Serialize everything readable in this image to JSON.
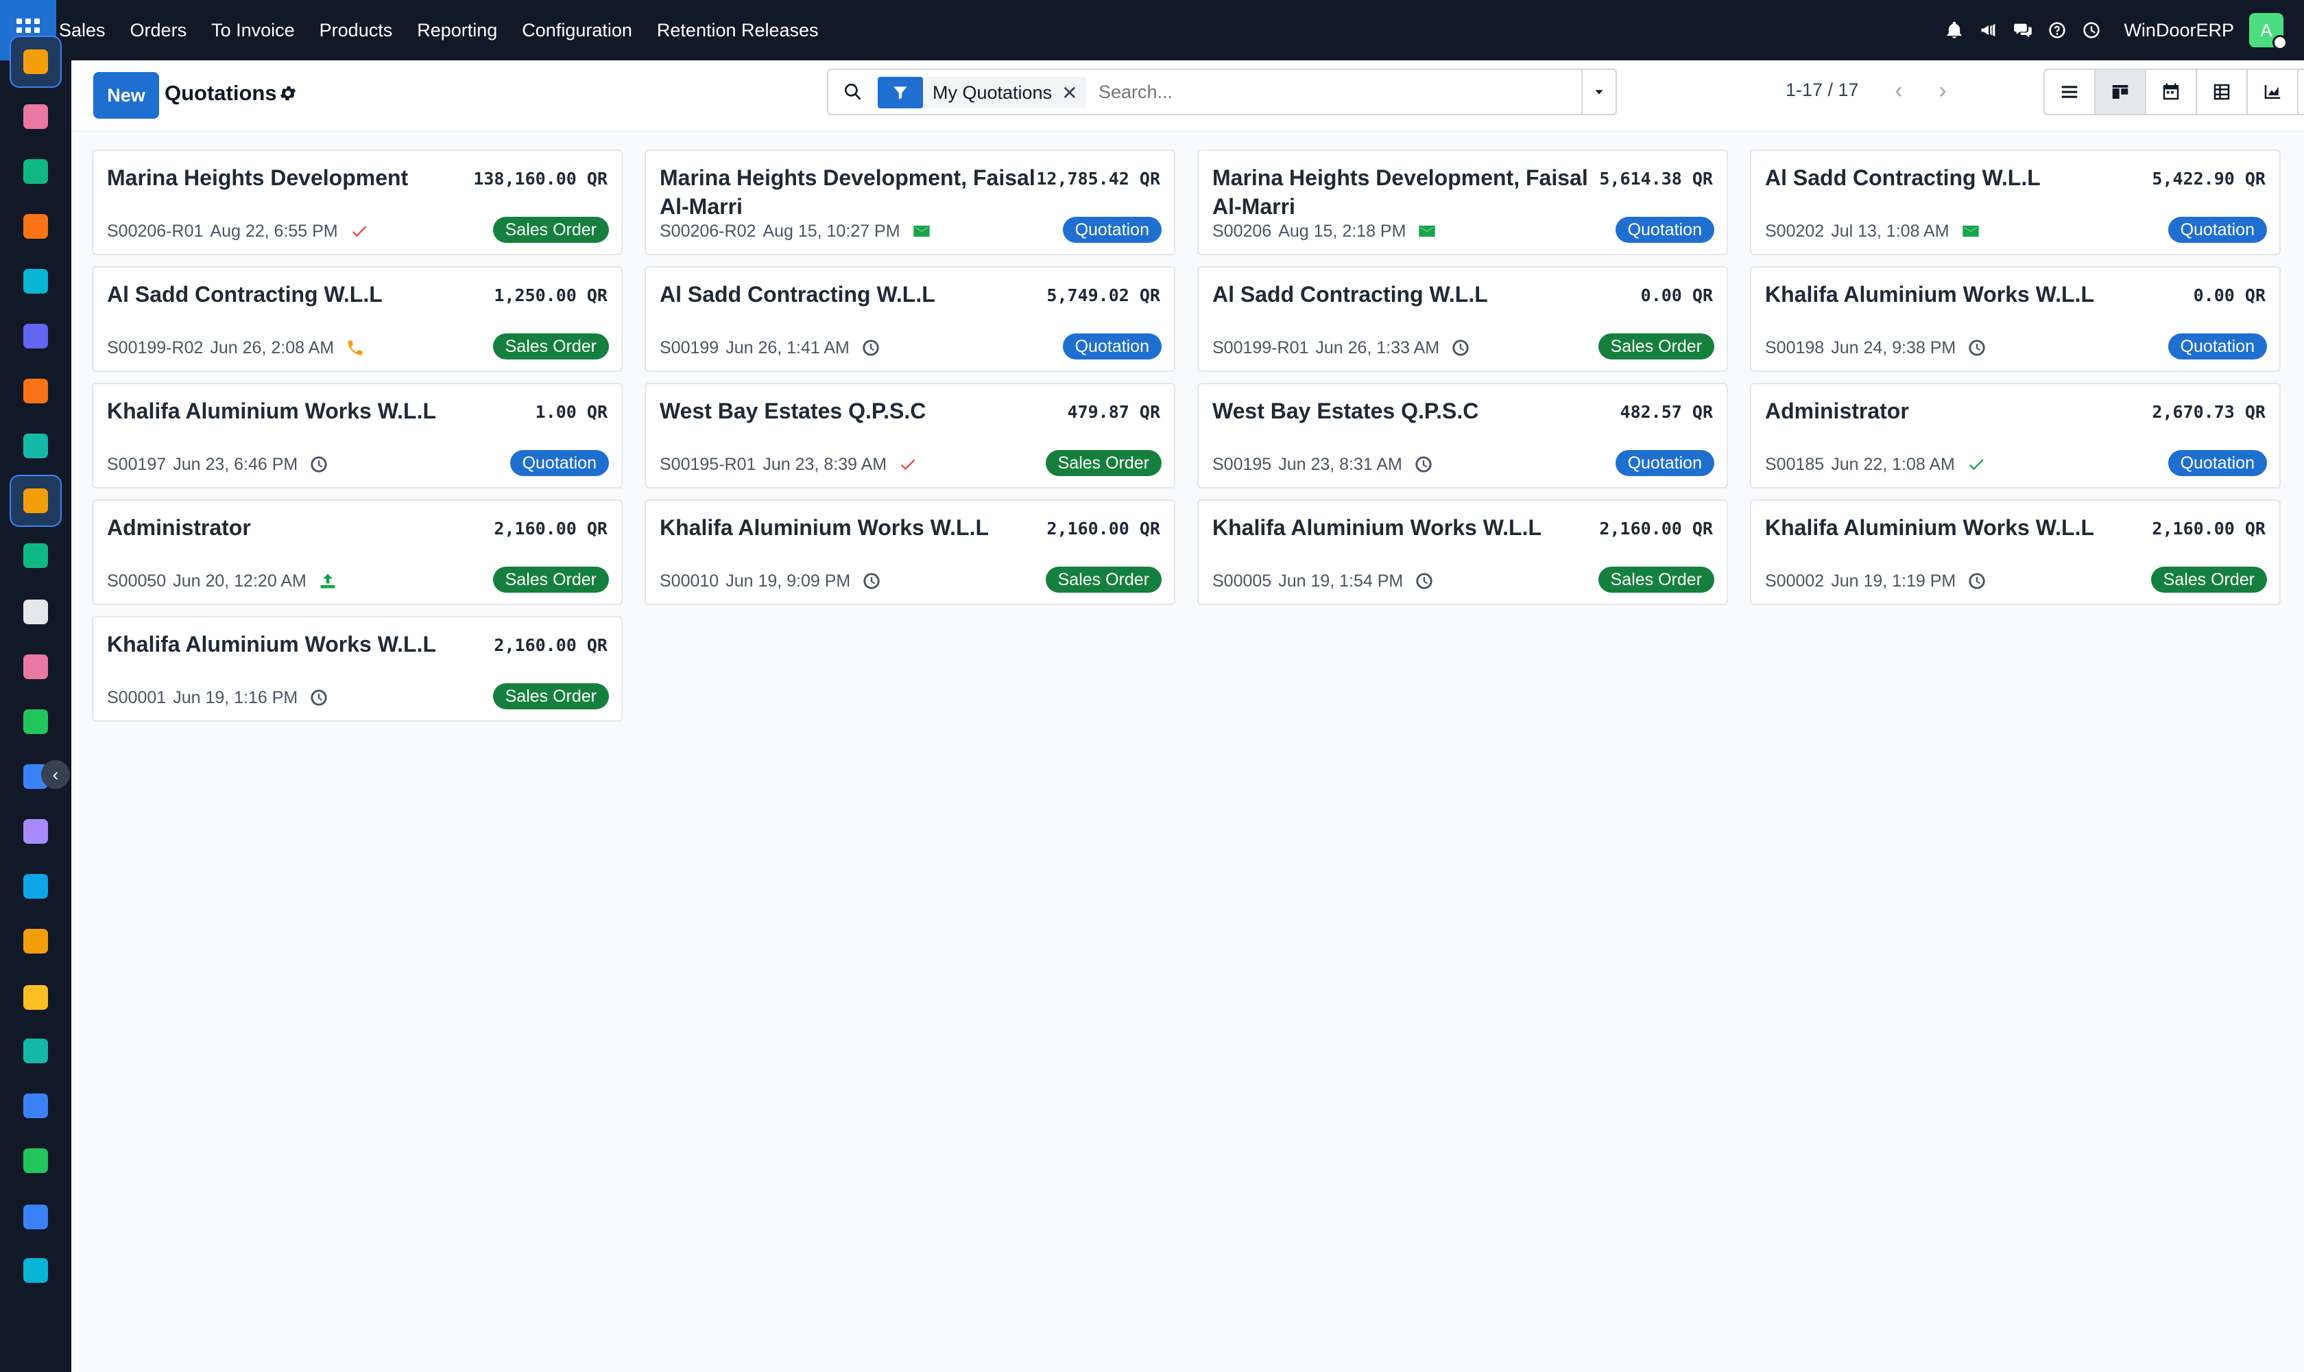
{
  "topbar": {
    "menu": [
      "Sales",
      "Orders",
      "To Invoice",
      "Products",
      "Reporting",
      "Configuration",
      "Retention Releases"
    ],
    "company": "WinDoorERP",
    "avatar_letter": "A"
  },
  "control": {
    "new_label": "New",
    "title": "Quotations",
    "facet_label": "My Quotations",
    "facet_remove": "✕",
    "search_placeholder": "Search...",
    "pager": "1-17 / 17"
  },
  "colors": {
    "quotation": "#1f6fd1",
    "sales_order": "#15803d",
    "topbar": "#111827"
  },
  "cards": [
    {
      "name": "Marina Heights Development",
      "amount": "138,160.00 QR",
      "ref": "S00206-R01",
      "date": "Aug 22, 6:55 PM",
      "activity": "check-done-icon",
      "status": "Sales Order"
    },
    {
      "name": "Marina Heights Development, Faisal Al-Marri",
      "amount": "12,785.42 QR",
      "ref": "S00206-R02",
      "date": "Aug 15, 10:27 PM",
      "activity": "email-icon",
      "status": "Quotation"
    },
    {
      "name": "Marina Heights Development, Faisal Al-Marri",
      "amount": "5,614.38 QR",
      "ref": "S00206",
      "date": "Aug 15, 2:18 PM",
      "activity": "email-icon",
      "status": "Quotation"
    },
    {
      "name": "Al Sadd Contracting W.L.L",
      "amount": "5,422.90 QR",
      "ref": "S00202",
      "date": "Jul 13, 1:08 AM",
      "activity": "email-icon",
      "status": "Quotation"
    },
    {
      "name": "Al Sadd Contracting W.L.L",
      "amount": "1,250.00 QR",
      "ref": "S00199-R02",
      "date": "Jun 26, 2:08 AM",
      "activity": "phone-icon",
      "status": "Sales Order"
    },
    {
      "name": "Al Sadd Contracting W.L.L",
      "amount": "5,749.02 QR",
      "ref": "S00199",
      "date": "Jun 26, 1:41 AM",
      "activity": "clock-icon",
      "status": "Quotation"
    },
    {
      "name": "Al Sadd Contracting W.L.L",
      "amount": "0.00 QR",
      "ref": "S00199-R01",
      "date": "Jun 26, 1:33 AM",
      "activity": "clock-icon",
      "status": "Sales Order"
    },
    {
      "name": "Khalifa Aluminium Works W.L.L",
      "amount": "0.00 QR",
      "ref": "S00198",
      "date": "Jun 24, 9:38 PM",
      "activity": "clock-icon",
      "status": "Quotation"
    },
    {
      "name": "Khalifa Aluminium Works W.L.L",
      "amount": "1.00 QR",
      "ref": "S00197",
      "date": "Jun 23, 6:46 PM",
      "activity": "clock-icon",
      "status": "Quotation"
    },
    {
      "name": "West Bay Estates Q.P.S.C",
      "amount": "479.87 QR",
      "ref": "S00195-R01",
      "date": "Jun 23, 8:39 AM",
      "activity": "check-done-icon",
      "status": "Sales Order"
    },
    {
      "name": "West Bay Estates Q.P.S.C",
      "amount": "482.57 QR",
      "ref": "S00195",
      "date": "Jun 23, 8:31 AM",
      "activity": "clock-icon",
      "status": "Quotation"
    },
    {
      "name": "Administrator",
      "amount": "2,670.73 QR",
      "ref": "S00185",
      "date": "Jun 22, 1:08 AM",
      "activity": "check-green-icon",
      "status": "Quotation"
    },
    {
      "name": "Administrator",
      "amount": "2,160.00 QR",
      "ref": "S00050",
      "date": "Jun 20, 12:20 AM",
      "activity": "upload-icon",
      "status": "Sales Order"
    },
    {
      "name": "Khalifa Aluminium Works W.L.L",
      "amount": "2,160.00 QR",
      "ref": "S00010",
      "date": "Jun 19, 9:09 PM",
      "activity": "clock-icon",
      "status": "Sales Order"
    },
    {
      "name": "Khalifa Aluminium Works W.L.L",
      "amount": "2,160.00 QR",
      "ref": "S00005",
      "date": "Jun 19, 1:54 PM",
      "activity": "clock-icon",
      "status": "Sales Order"
    },
    {
      "name": "Khalifa Aluminium Works W.L.L",
      "amount": "2,160.00 QR",
      "ref": "S00002",
      "date": "Jun 19, 1:19 PM",
      "activity": "clock-icon",
      "status": "Sales Order"
    },
    {
      "name": "Khalifa Aluminium Works W.L.L",
      "amount": "2,160.00 QR",
      "ref": "S00001",
      "date": "Jun 19, 1:16 PM",
      "activity": "clock-icon",
      "status": "Sales Order"
    }
  ],
  "sidebar": {
    "apps": [
      {
        "icon": "sales-app-icon",
        "color": "#f59e0b",
        "active": true
      },
      {
        "icon": "survey-app-icon",
        "color": "#e879a0",
        "active": false
      },
      {
        "icon": "contacts-app-icon",
        "color": "#10b981",
        "active": false
      },
      {
        "icon": "discuss-app-icon",
        "color": "#f97316",
        "active": false
      },
      {
        "icon": "website-app-icon",
        "color": "#06b6d4",
        "active": false
      },
      {
        "icon": "email-marketing-app-icon",
        "color": "#6366f1",
        "active": false
      },
      {
        "icon": "livechat-app-icon",
        "color": "#f97316",
        "active": false
      },
      {
        "icon": "crm-app-icon",
        "color": "#14b8a6",
        "active": false
      },
      {
        "icon": "sales-app-icon-2",
        "color": "#f59e0b",
        "active": true
      },
      {
        "icon": "employees-app-icon",
        "color": "#10b981",
        "active": false
      },
      {
        "icon": "inventory-app-icon",
        "color": "#e5e7eb",
        "active": false
      },
      {
        "icon": "apps-app-icon",
        "color": "#e879a0",
        "active": false
      },
      {
        "icon": "project-app-icon",
        "color": "#22c55e",
        "active": false
      },
      {
        "icon": "knowledge-app-icon",
        "color": "#3b82f6",
        "active": false
      },
      {
        "icon": "purchase-app-icon",
        "color": "#a78bfa",
        "active": false
      },
      {
        "icon": "invoicing-app-icon",
        "color": "#0ea5e9",
        "active": false
      },
      {
        "icon": "team-app-icon",
        "color": "#f59e0b",
        "active": false
      },
      {
        "icon": "calendar-app-icon",
        "color": "#fbbf24",
        "active": false
      },
      {
        "icon": "sign-app-icon",
        "color": "#14b8a6",
        "active": false
      },
      {
        "icon": "dashboard-app-icon",
        "color": "#3b82f6",
        "active": false
      },
      {
        "icon": "whatsapp-app-icon",
        "color": "#22c55e",
        "active": false
      },
      {
        "icon": "timer-app-icon",
        "color": "#3b82f6",
        "active": false
      },
      {
        "icon": "website-app-icon-2",
        "color": "#06b6d4",
        "active": false
      }
    ]
  }
}
